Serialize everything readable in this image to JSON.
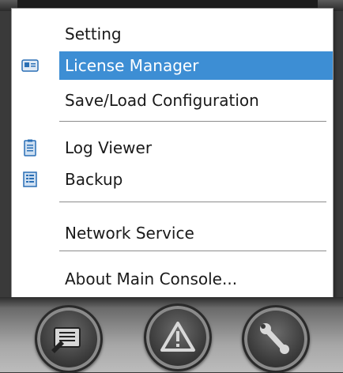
{
  "menu": {
    "items": [
      {
        "label": "Setting",
        "icon": null
      },
      {
        "label": "License Manager",
        "icon": "license-card-icon",
        "highlighted": true
      },
      {
        "label": "Save/Load Configuration",
        "icon": null
      },
      {
        "label": "Log Viewer",
        "icon": "clipboard-log-icon"
      },
      {
        "label": "Backup",
        "icon": "backup-list-icon"
      },
      {
        "label": "Network Service",
        "icon": null
      },
      {
        "label": "About Main Console...",
        "icon": null
      }
    ]
  },
  "toolbar": {
    "buttons": [
      {
        "icon": "monitor-icon"
      },
      {
        "icon": "alert-icon"
      },
      {
        "icon": "wrench-icon"
      }
    ]
  },
  "colors": {
    "highlight": "#3d8ed4",
    "menu_background": "#ffffff",
    "icon_blue": "#2a6fb5"
  }
}
